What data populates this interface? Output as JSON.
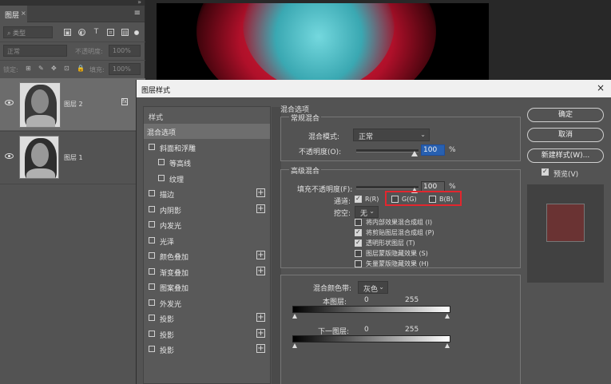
{
  "layers_panel": {
    "tab_label": "图层",
    "tab_close": "×",
    "menu_icon": "≡",
    "collapse_icon": "»",
    "filter_kind": "类型",
    "blend_mode": "正常",
    "opacity_label": "不透明度:",
    "opacity_value": "100%",
    "lock_label": "锁定:",
    "fill_label": "填充:",
    "fill_value": "100%",
    "layers": [
      {
        "name": "图层 2",
        "selected": true
      },
      {
        "name": "图层 1",
        "selected": false
      }
    ]
  },
  "dialog": {
    "title": "图层样式",
    "close": "×",
    "styles_header": "样式",
    "styles": [
      {
        "label": "混合选项",
        "checkbox": false,
        "plus": false,
        "selected": true,
        "indent": 0
      },
      {
        "label": "斜面和浮雕",
        "checkbox": true,
        "plus": false,
        "selected": false,
        "indent": 0
      },
      {
        "label": "等高线",
        "checkbox": true,
        "plus": false,
        "selected": false,
        "indent": 1
      },
      {
        "label": "纹理",
        "checkbox": true,
        "plus": false,
        "selected": false,
        "indent": 1
      },
      {
        "label": "描边",
        "checkbox": true,
        "plus": true,
        "selected": false,
        "indent": 0
      },
      {
        "label": "内阴影",
        "checkbox": true,
        "plus": true,
        "selected": false,
        "indent": 0
      },
      {
        "label": "内发光",
        "checkbox": true,
        "plus": false,
        "selected": false,
        "indent": 0
      },
      {
        "label": "光泽",
        "checkbox": true,
        "plus": false,
        "selected": false,
        "indent": 0
      },
      {
        "label": "颜色叠加",
        "checkbox": true,
        "plus": true,
        "selected": false,
        "indent": 0
      },
      {
        "label": "渐变叠加",
        "checkbox": true,
        "plus": true,
        "selected": false,
        "indent": 0
      },
      {
        "label": "图案叠加",
        "checkbox": true,
        "plus": false,
        "selected": false,
        "indent": 0
      },
      {
        "label": "外发光",
        "checkbox": true,
        "plus": false,
        "selected": false,
        "indent": 0
      },
      {
        "label": "投影",
        "checkbox": true,
        "plus": true,
        "selected": false,
        "indent": 0
      },
      {
        "label": "投影",
        "checkbox": true,
        "plus": true,
        "selected": false,
        "indent": 0
      },
      {
        "label": "投影",
        "checkbox": true,
        "plus": true,
        "selected": false,
        "indent": 0
      }
    ],
    "blend_options_title": "混合选项",
    "general_title": "常规混合",
    "blend_mode_label": "混合模式:",
    "blend_mode_value": "正常",
    "opacity_label": "不透明度(O):",
    "opacity_value": "100",
    "opacity_unit": "%",
    "advanced_title": "高级混合",
    "fill_opacity_label": "填充不透明度(F):",
    "fill_opacity_value": "100",
    "fill_opacity_unit": "%",
    "channels_label": "通道:",
    "channels": [
      {
        "label": "R(R)",
        "checked": true
      },
      {
        "label": "G(G)",
        "checked": false
      },
      {
        "label": "B(B)",
        "checked": false
      }
    ],
    "knockout_label": "挖空:",
    "knockout_value": "无",
    "adv_options": [
      {
        "label": "将内部效果混合成组 (I)",
        "checked": false
      },
      {
        "label": "将剪贴图层混合成组 (P)",
        "checked": true
      },
      {
        "label": "透明形状图层 (T)",
        "checked": true
      },
      {
        "label": "图层蒙版隐藏效果 (S)",
        "checked": false
      },
      {
        "label": "矢量蒙版隐藏效果 (H)",
        "checked": false
      }
    ],
    "blend_if_label": "混合颜色带:",
    "blend_if_value": "灰色",
    "this_layer_label": "本图层:",
    "this_layer_min": "0",
    "this_layer_max": "255",
    "underlying_label": "下一图层:",
    "underlying_min": "0",
    "underlying_max": "255",
    "buttons": {
      "ok": "确定",
      "cancel": "取消",
      "new_style": "新建样式(W)..."
    },
    "preview_label": "预览(V)",
    "preview_checked": true,
    "preview_swatch_color": "#6a3333",
    "highlight_color": "#e2262e"
  }
}
